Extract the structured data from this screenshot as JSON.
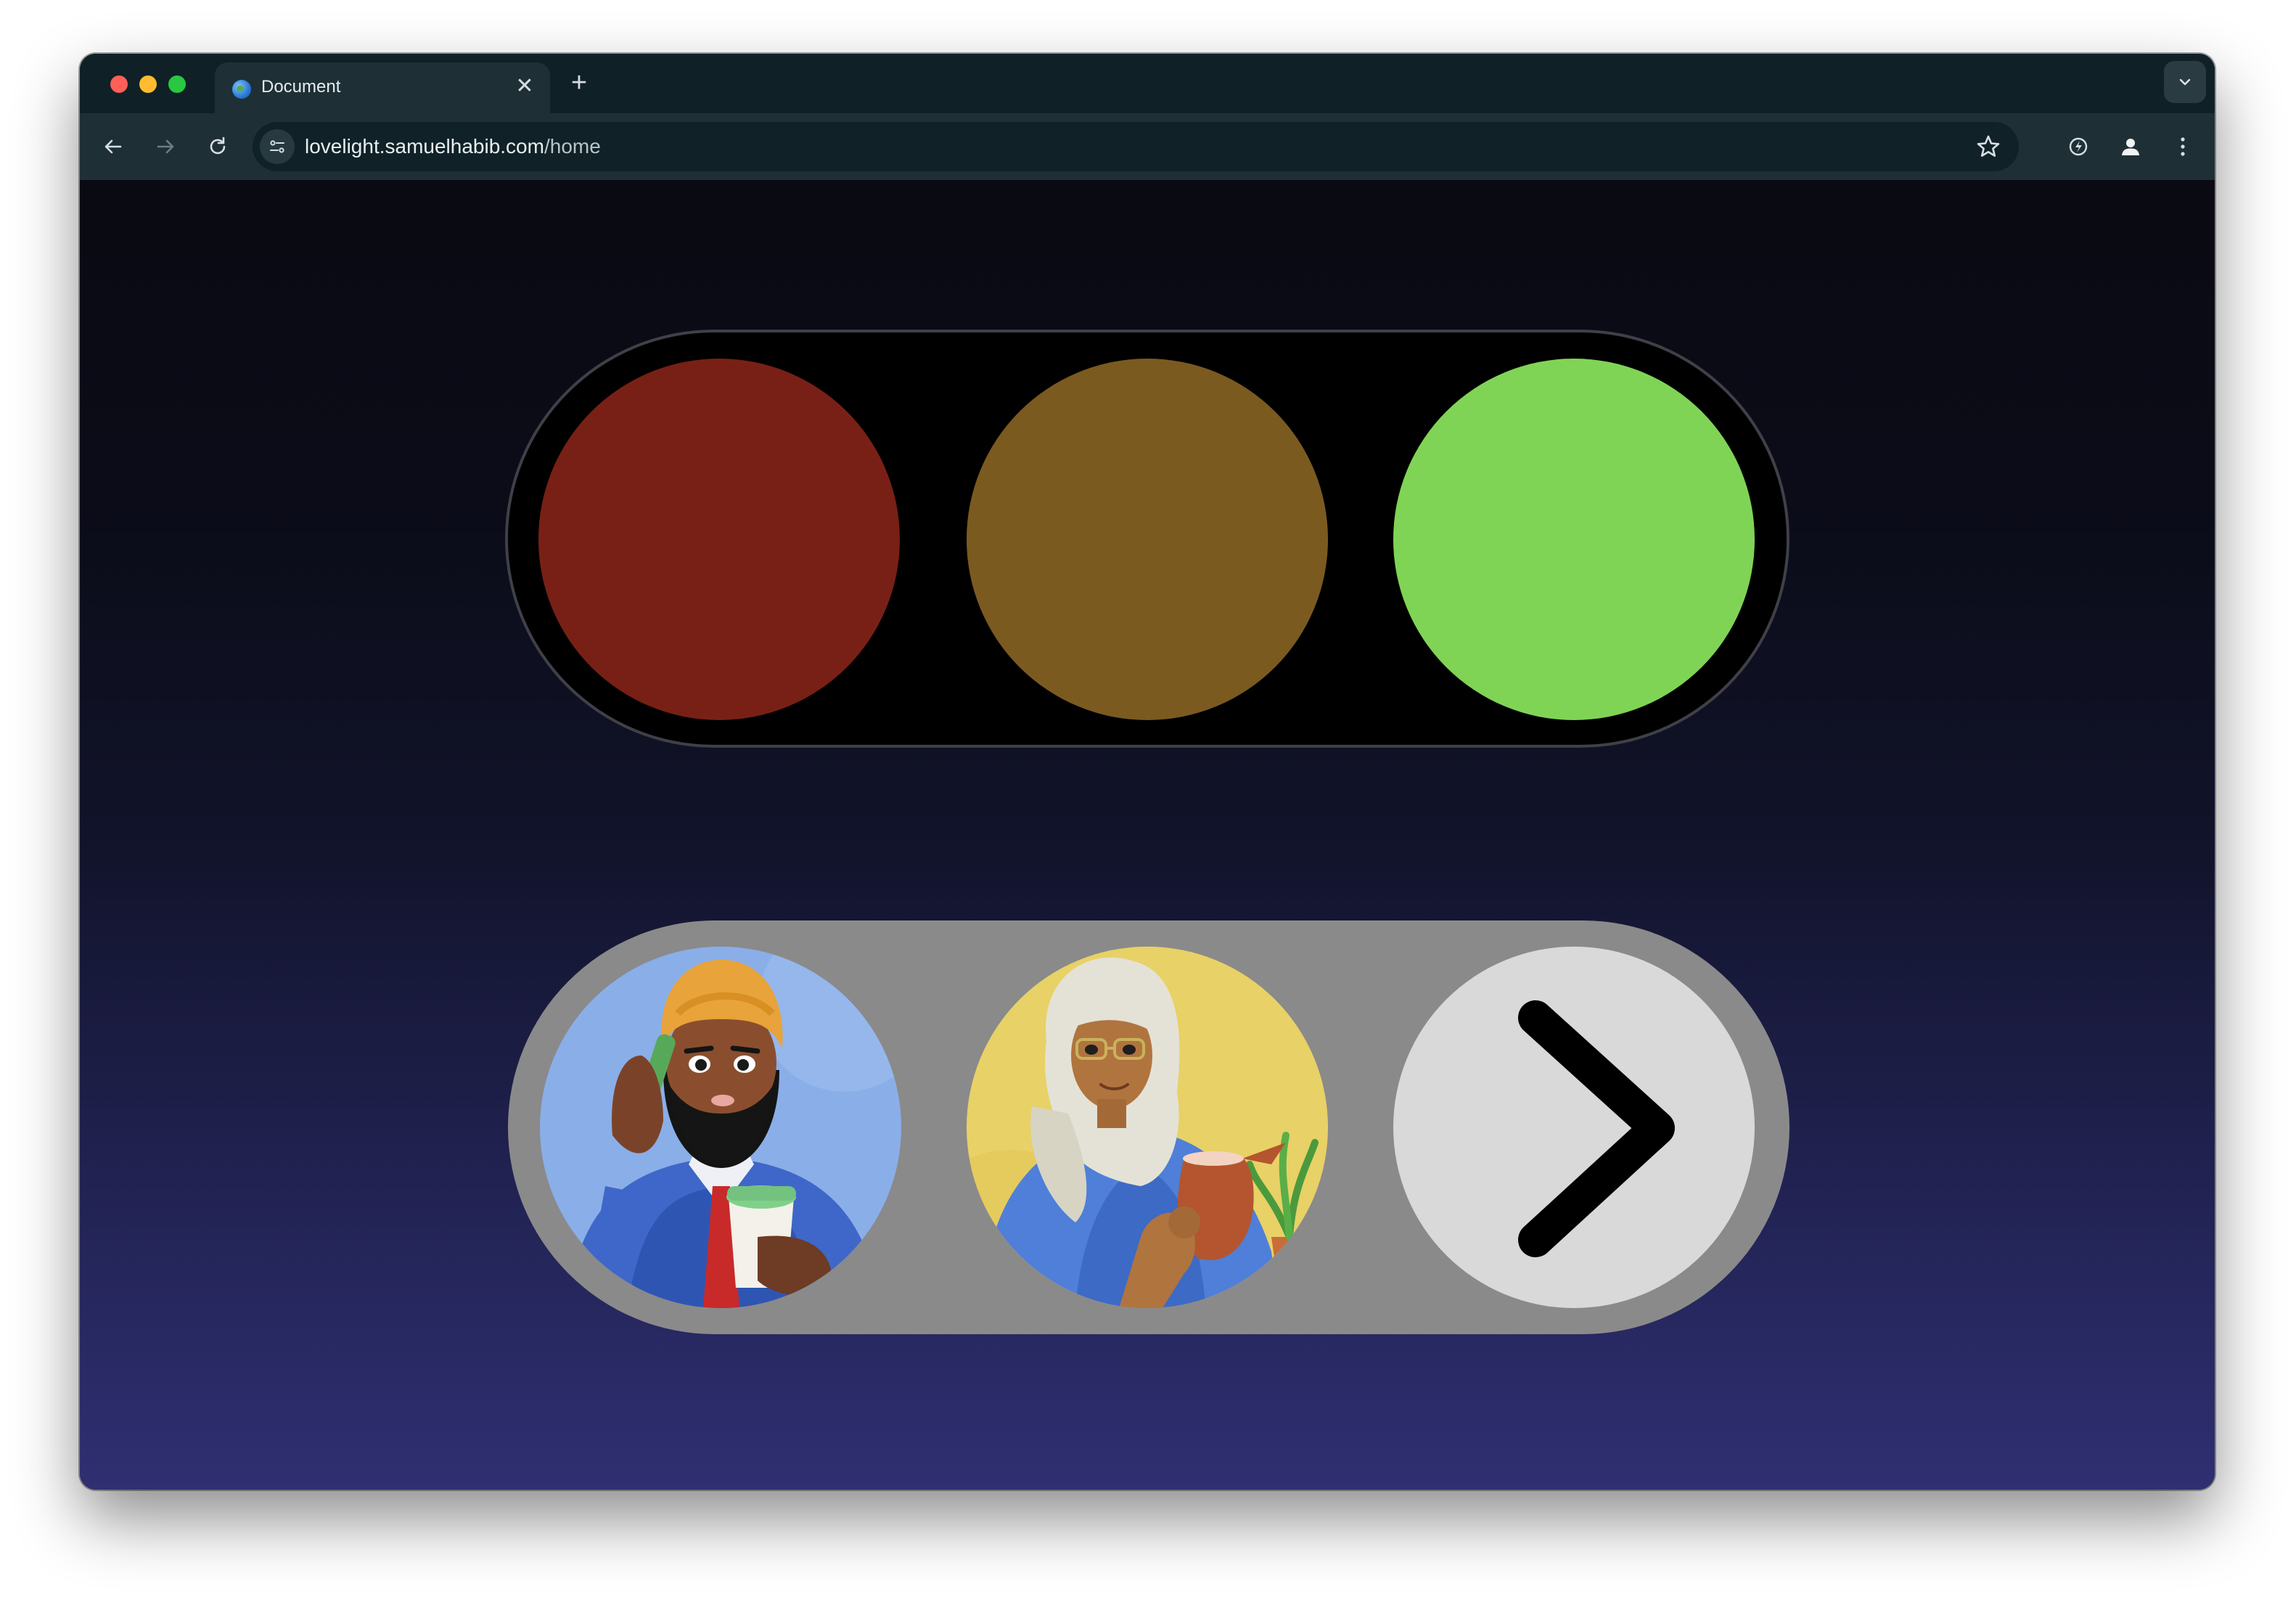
{
  "browser": {
    "tab_title": "Document",
    "url_host": "lovelight.samuelhabib.com",
    "url_path": "/home"
  },
  "traffic_light": {
    "lamps": [
      {
        "name": "red",
        "color": "#782016",
        "state": "off"
      },
      {
        "name": "yellow",
        "color": "#7b5a20",
        "state": "off"
      },
      {
        "name": "green",
        "color": "#80d455",
        "state": "on"
      }
    ]
  },
  "selector": {
    "avatars": [
      {
        "name": "man-in-turban-with-coffee",
        "background": "#8aaee8"
      },
      {
        "name": "woman-with-pitcher-and-plant",
        "background": "#e8d166"
      }
    ],
    "next_icon": "chevron-right-icon"
  }
}
